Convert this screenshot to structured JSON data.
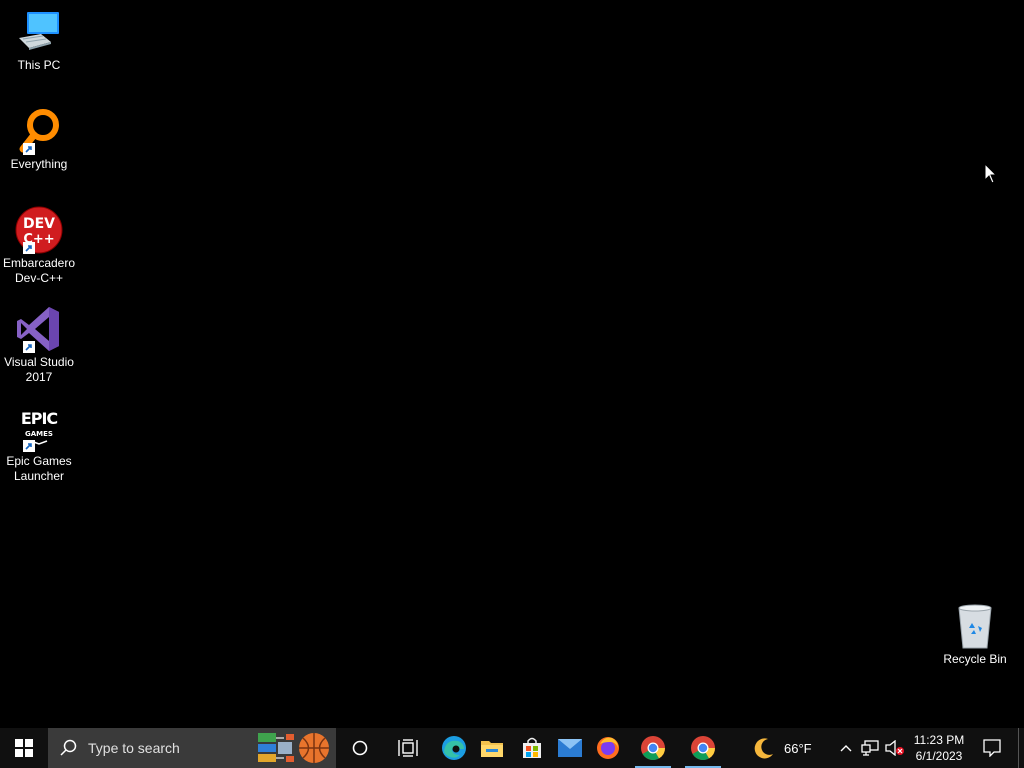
{
  "desktop": {
    "icons": [
      {
        "label": "This PC",
        "icon": "this-pc-icon"
      },
      {
        "label": "Everything",
        "icon": "everything-icon"
      },
      {
        "label": "Embarcadero\nDev-C++",
        "icon": "devcpp-icon"
      },
      {
        "label": "Visual Studio\n2017",
        "icon": "visual-studio-icon"
      },
      {
        "label": "Epic Games\nLauncher",
        "icon": "epic-games-icon"
      },
      {
        "label": "Recycle Bin",
        "icon": "recycle-bin-icon"
      }
    ]
  },
  "taskbar": {
    "search_placeholder": "Type to search",
    "apps": [
      {
        "name": "Cortana",
        "icon": "cortana-icon"
      },
      {
        "name": "Task View",
        "icon": "task-view-icon"
      },
      {
        "name": "Microsoft Edge",
        "icon": "edge-icon"
      },
      {
        "name": "File Explorer",
        "icon": "file-explorer-icon"
      },
      {
        "name": "Microsoft Store",
        "icon": "store-icon"
      },
      {
        "name": "Mail",
        "icon": "mail-icon"
      },
      {
        "name": "Firefox",
        "icon": "firefox-icon"
      },
      {
        "name": "Google Chrome",
        "icon": "chrome-icon"
      },
      {
        "name": "Google Chrome",
        "icon": "chrome-icon"
      }
    ],
    "weather": {
      "temp": "66°F",
      "icon": "moon-weather-icon"
    },
    "clock": {
      "time": "11:23 PM",
      "date": "6/1/2023"
    }
  },
  "colors": {
    "desktop_bg": "#000000",
    "taskbar_bg": "#101010",
    "search_bg": "#3a3a3a",
    "active_indicator": "#76b9ed"
  }
}
